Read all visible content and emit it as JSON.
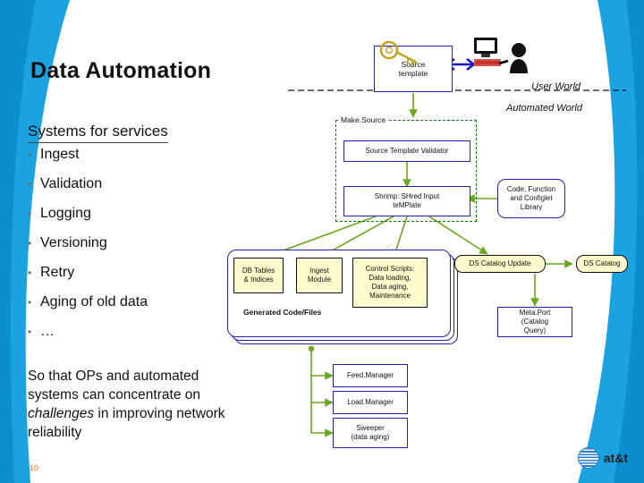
{
  "slide": {
    "title": "Data Automation",
    "subtitle": "Systems for services",
    "page_number": "10",
    "closing_line1": "So that OPs and automated",
    "closing_line2": "systems can concentrate on",
    "closing_italic": "challenges",
    "closing_line3": " in improving network",
    "closing_line4": "reliability",
    "brand": "at&t"
  },
  "bullets": [
    {
      "marker": "•",
      "label": "Ingest"
    },
    {
      "marker": "•",
      "label": "Validation"
    },
    {
      "marker": "•",
      "label": "Logging"
    },
    {
      "marker": "•",
      "label": "Versioning"
    },
    {
      "marker": "•",
      "label": "Retry"
    },
    {
      "marker": "•",
      "label": "Aging of old data"
    },
    {
      "marker": "•",
      "label": "…"
    }
  ],
  "diagram": {
    "source_template": "Source\ntemplate",
    "source_template_line1": "Source",
    "source_template_line2": "template",
    "user_world": "User World",
    "automated_world": "Automated World",
    "make_source": "Make.Source",
    "source_template_validator": "Source Template Validator",
    "shrimp_line1": "Shrimp: SHred Input",
    "shrimp_line2": "teMPlate",
    "code_function_lib_line1": "Code, Function",
    "code_function_lib_line2": "and Configlet",
    "code_function_lib_line3": "Library",
    "db_tables_line1": "DB Tables",
    "db_tables_line2": "& Indices",
    "ingest_module_line1": "Ingest",
    "ingest_module_line2": "Module",
    "control_scripts_line1": "Control Scripts:",
    "control_scripts_line2": "Data loading,",
    "control_scripts_line3": "Data aging,",
    "control_scripts_line4": "Maintenance",
    "generated_code_files": "Generated Code/Files",
    "ds_catalog_update": "DS Catalog Update",
    "ds_catalog": "DS Catalog",
    "metaport_line1": "Meta.Port",
    "metaport_line2": "(Catalog",
    "metaport_line3": "Query)",
    "feed_manager": "Feed.Manager",
    "load_manager": "Load.Manager",
    "sweeper_line1": "Sweeper",
    "sweeper_line2": "(data aging)"
  },
  "colors": {
    "accent_orange": "#e8711a",
    "swoosh_blue": "#1aa3e0",
    "arrow_green": "#6aa81e",
    "box_blue": "#2222aa",
    "dashed_green": "#0a7a0a",
    "yellow_fill": "#fffbcc"
  }
}
